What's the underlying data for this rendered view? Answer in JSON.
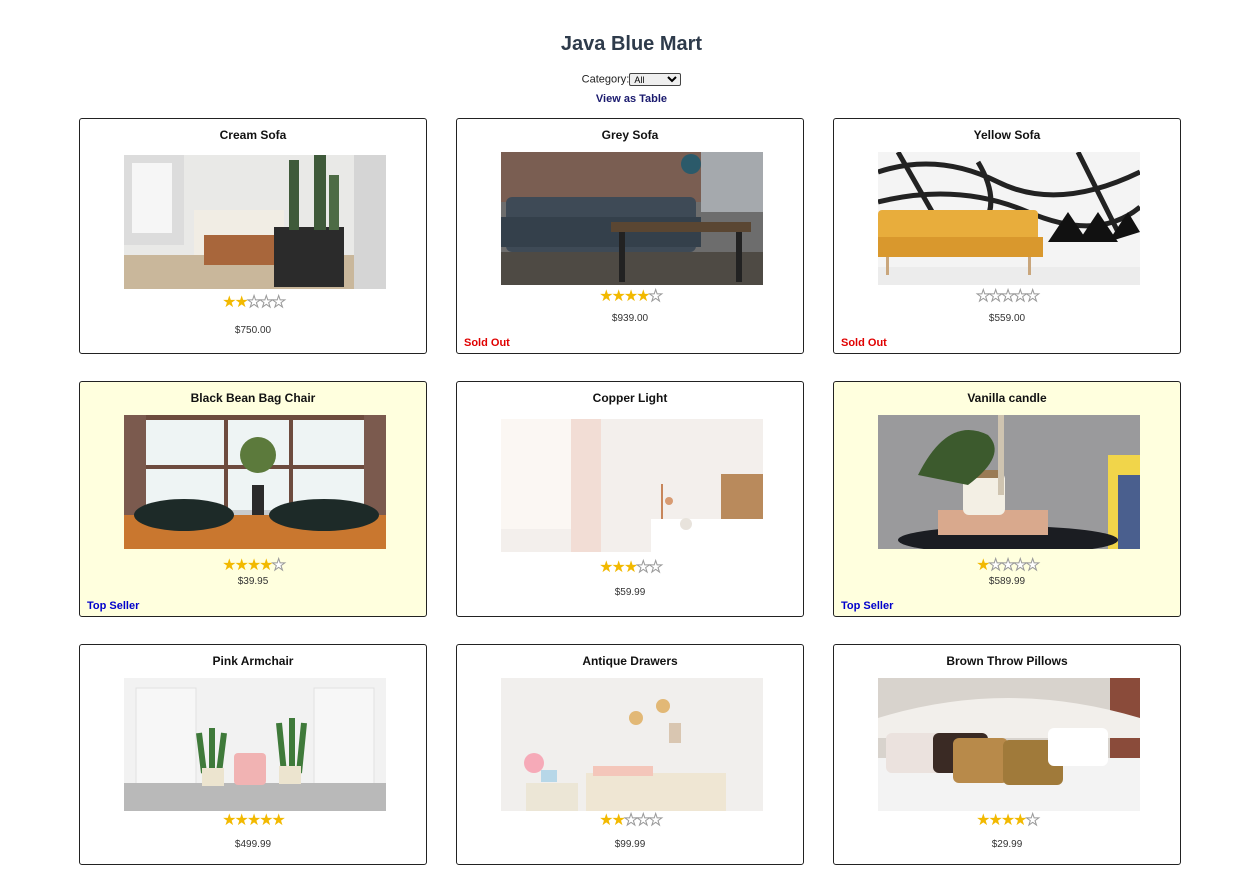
{
  "store": {
    "title": "Java Blue Mart",
    "category_label": "Category:",
    "category_selected": "All",
    "view_table_label": "View as Table"
  },
  "products": [
    {
      "name": "Cream Sofa",
      "price": "$750.00",
      "rating": 2,
      "badge": "",
      "image": "cream-sofa-photo"
    },
    {
      "name": "Grey Sofa",
      "price": "$939.00",
      "rating": 4,
      "badge": "Sold Out",
      "image": "grey-sofa-photo"
    },
    {
      "name": "Yellow Sofa",
      "price": "$559.00",
      "rating": 0,
      "badge": "Sold Out",
      "image": "yellow-sofa-photo"
    },
    {
      "name": "Black Bean Bag Chair",
      "price": "$39.95",
      "rating": 4,
      "badge": "Top Seller",
      "image": "bean-bag-photo"
    },
    {
      "name": "Copper Light",
      "price": "$59.99",
      "rating": 3,
      "badge": "",
      "image": "copper-light-photo"
    },
    {
      "name": "Vanilla candle",
      "price": "$589.99",
      "rating": 1,
      "badge": "Top Seller",
      "image": "vanilla-candle-photo"
    },
    {
      "name": "Pink Armchair",
      "price": "$499.99",
      "rating": 5,
      "badge": "",
      "image": "pink-armchair-photo"
    },
    {
      "name": "Antique Drawers",
      "price": "$99.99",
      "rating": 2,
      "badge": "",
      "image": "antique-drawers-photo"
    },
    {
      "name": "Brown Throw Pillows",
      "price": "$29.99",
      "rating": 4,
      "badge": "",
      "image": "throw-pillows-photo"
    }
  ],
  "rating_max": 5,
  "colors": {
    "star": "#f2b900",
    "sold_out": "#e00000",
    "top_seller": "#0000cc",
    "top_seller_bg": "#ffffde",
    "title": "#2e3b4b"
  }
}
